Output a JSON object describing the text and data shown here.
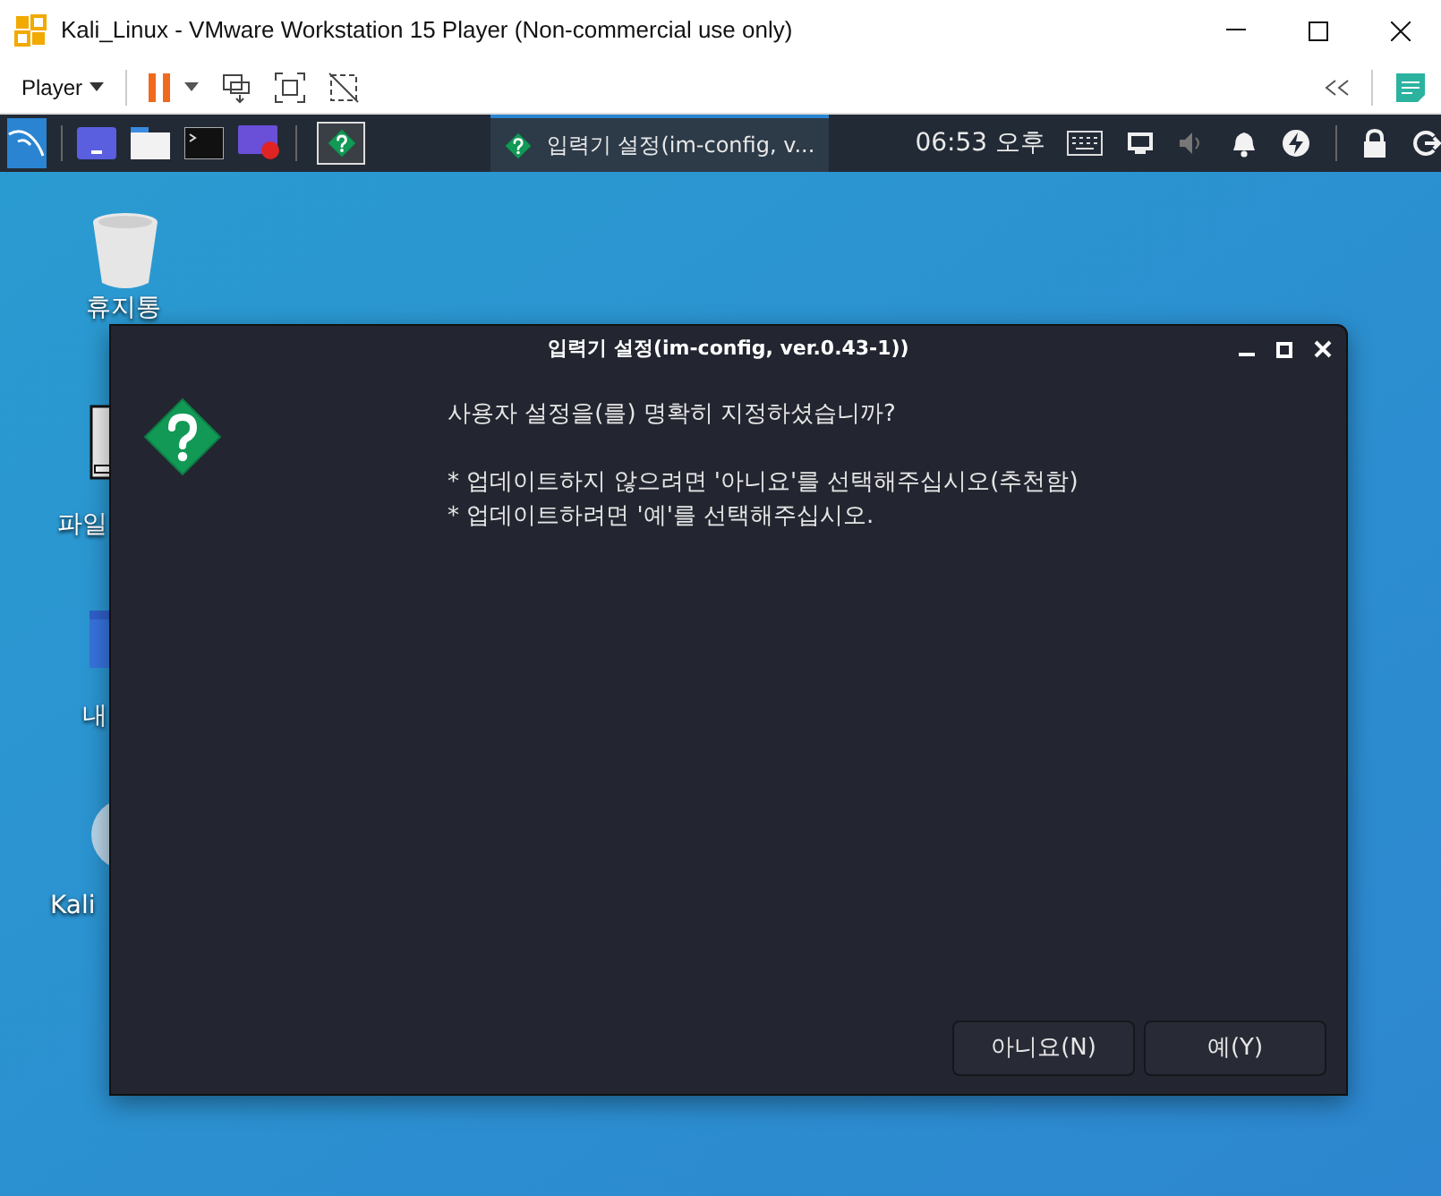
{
  "window": {
    "title": "Kali_Linux - VMware Workstation 15 Player (Non-commercial use only)"
  },
  "toolbar": {
    "menu": "Player"
  },
  "panel": {
    "task": {
      "title": "입력기 설정(im-config, v...",
      "selected": true
    },
    "clock": "06:53 오후"
  },
  "desktop_icons": [
    {
      "label": "휴지통"
    },
    {
      "label": "파일"
    },
    {
      "label": "내"
    },
    {
      "label": "Kali"
    }
  ],
  "dialog": {
    "title": "입력기 설정(im-config, ver.0.43-1))",
    "question": "사용자 설정을(를) 명확히 지정하셨습니까?",
    "notes": [
      "* 업데이트하지 않으려면 '아니요'를 선택해주십시오(추천함)",
      "* 업데이트하려면 '예'를 선택해주십시오."
    ],
    "buttons": [
      "아니요(N)",
      "예(Y)"
    ]
  }
}
